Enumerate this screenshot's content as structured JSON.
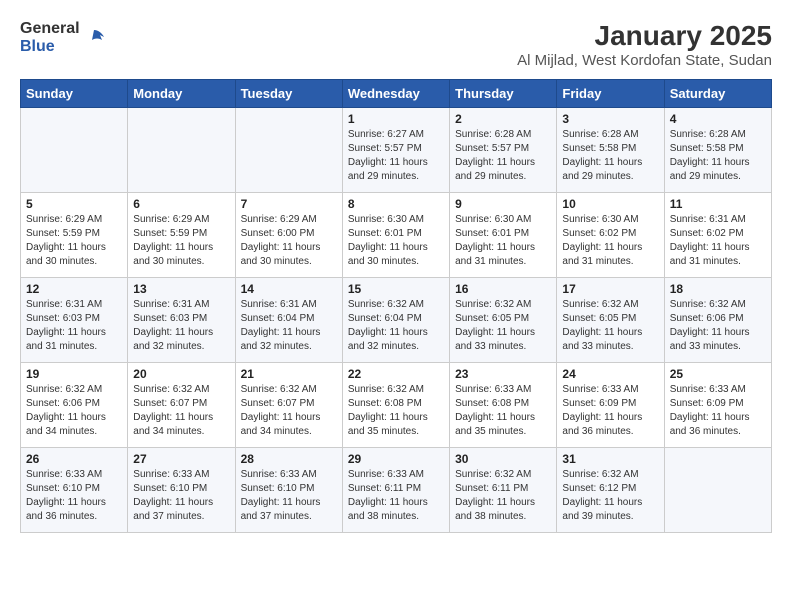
{
  "logo": {
    "name_part1": "General",
    "name_part2": "Blue"
  },
  "title": "January 2025",
  "subtitle": "Al Mijlad, West Kordofan State, Sudan",
  "days_of_week": [
    "Sunday",
    "Monday",
    "Tuesday",
    "Wednesday",
    "Thursday",
    "Friday",
    "Saturday"
  ],
  "weeks": [
    [
      {
        "day": "",
        "info": ""
      },
      {
        "day": "",
        "info": ""
      },
      {
        "day": "",
        "info": ""
      },
      {
        "day": "1",
        "info": "Sunrise: 6:27 AM\nSunset: 5:57 PM\nDaylight: 11 hours\nand 29 minutes."
      },
      {
        "day": "2",
        "info": "Sunrise: 6:28 AM\nSunset: 5:57 PM\nDaylight: 11 hours\nand 29 minutes."
      },
      {
        "day": "3",
        "info": "Sunrise: 6:28 AM\nSunset: 5:58 PM\nDaylight: 11 hours\nand 29 minutes."
      },
      {
        "day": "4",
        "info": "Sunrise: 6:28 AM\nSunset: 5:58 PM\nDaylight: 11 hours\nand 29 minutes."
      }
    ],
    [
      {
        "day": "5",
        "info": "Sunrise: 6:29 AM\nSunset: 5:59 PM\nDaylight: 11 hours\nand 30 minutes."
      },
      {
        "day": "6",
        "info": "Sunrise: 6:29 AM\nSunset: 5:59 PM\nDaylight: 11 hours\nand 30 minutes."
      },
      {
        "day": "7",
        "info": "Sunrise: 6:29 AM\nSunset: 6:00 PM\nDaylight: 11 hours\nand 30 minutes."
      },
      {
        "day": "8",
        "info": "Sunrise: 6:30 AM\nSunset: 6:01 PM\nDaylight: 11 hours\nand 30 minutes."
      },
      {
        "day": "9",
        "info": "Sunrise: 6:30 AM\nSunset: 6:01 PM\nDaylight: 11 hours\nand 31 minutes."
      },
      {
        "day": "10",
        "info": "Sunrise: 6:30 AM\nSunset: 6:02 PM\nDaylight: 11 hours\nand 31 minutes."
      },
      {
        "day": "11",
        "info": "Sunrise: 6:31 AM\nSunset: 6:02 PM\nDaylight: 11 hours\nand 31 minutes."
      }
    ],
    [
      {
        "day": "12",
        "info": "Sunrise: 6:31 AM\nSunset: 6:03 PM\nDaylight: 11 hours\nand 31 minutes."
      },
      {
        "day": "13",
        "info": "Sunrise: 6:31 AM\nSunset: 6:03 PM\nDaylight: 11 hours\nand 32 minutes."
      },
      {
        "day": "14",
        "info": "Sunrise: 6:31 AM\nSunset: 6:04 PM\nDaylight: 11 hours\nand 32 minutes."
      },
      {
        "day": "15",
        "info": "Sunrise: 6:32 AM\nSunset: 6:04 PM\nDaylight: 11 hours\nand 32 minutes."
      },
      {
        "day": "16",
        "info": "Sunrise: 6:32 AM\nSunset: 6:05 PM\nDaylight: 11 hours\nand 33 minutes."
      },
      {
        "day": "17",
        "info": "Sunrise: 6:32 AM\nSunset: 6:05 PM\nDaylight: 11 hours\nand 33 minutes."
      },
      {
        "day": "18",
        "info": "Sunrise: 6:32 AM\nSunset: 6:06 PM\nDaylight: 11 hours\nand 33 minutes."
      }
    ],
    [
      {
        "day": "19",
        "info": "Sunrise: 6:32 AM\nSunset: 6:06 PM\nDaylight: 11 hours\nand 34 minutes."
      },
      {
        "day": "20",
        "info": "Sunrise: 6:32 AM\nSunset: 6:07 PM\nDaylight: 11 hours\nand 34 minutes."
      },
      {
        "day": "21",
        "info": "Sunrise: 6:32 AM\nSunset: 6:07 PM\nDaylight: 11 hours\nand 34 minutes."
      },
      {
        "day": "22",
        "info": "Sunrise: 6:32 AM\nSunset: 6:08 PM\nDaylight: 11 hours\nand 35 minutes."
      },
      {
        "day": "23",
        "info": "Sunrise: 6:33 AM\nSunset: 6:08 PM\nDaylight: 11 hours\nand 35 minutes."
      },
      {
        "day": "24",
        "info": "Sunrise: 6:33 AM\nSunset: 6:09 PM\nDaylight: 11 hours\nand 36 minutes."
      },
      {
        "day": "25",
        "info": "Sunrise: 6:33 AM\nSunset: 6:09 PM\nDaylight: 11 hours\nand 36 minutes."
      }
    ],
    [
      {
        "day": "26",
        "info": "Sunrise: 6:33 AM\nSunset: 6:10 PM\nDaylight: 11 hours\nand 36 minutes."
      },
      {
        "day": "27",
        "info": "Sunrise: 6:33 AM\nSunset: 6:10 PM\nDaylight: 11 hours\nand 37 minutes."
      },
      {
        "day": "28",
        "info": "Sunrise: 6:33 AM\nSunset: 6:10 PM\nDaylight: 11 hours\nand 37 minutes."
      },
      {
        "day": "29",
        "info": "Sunrise: 6:33 AM\nSunset: 6:11 PM\nDaylight: 11 hours\nand 38 minutes."
      },
      {
        "day": "30",
        "info": "Sunrise: 6:32 AM\nSunset: 6:11 PM\nDaylight: 11 hours\nand 38 minutes."
      },
      {
        "day": "31",
        "info": "Sunrise: 6:32 AM\nSunset: 6:12 PM\nDaylight: 11 hours\nand 39 minutes."
      },
      {
        "day": "",
        "info": ""
      }
    ]
  ]
}
